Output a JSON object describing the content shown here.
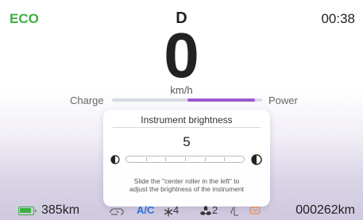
{
  "header": {
    "mode": "ECO",
    "gear": "D",
    "time": "00:38"
  },
  "speedometer": {
    "value": "0",
    "unit": "km/h"
  },
  "power_meter": {
    "left_label": "Charge",
    "right_label": "Power",
    "fill_start": 0.5,
    "fill_end": 0.95
  },
  "brightness_dialog": {
    "title": "Instrument brightness",
    "value": "5",
    "hint_line1": "Slide the \"center roller in the left\" to",
    "hint_line2": "adjust the brightness of the instrument",
    "segments": 6
  },
  "page_indicator": {
    "count": 8,
    "active_index": 4
  },
  "status_bar": {
    "range": "385km",
    "ac_label": "A/C",
    "fan_level": "4",
    "fan2_level": "2",
    "odometer": "000262km"
  },
  "colors": {
    "eco": "#3cb043",
    "accent": "#9b59d0",
    "ac": "#2a72d8",
    "heat": "#f08a4b"
  }
}
